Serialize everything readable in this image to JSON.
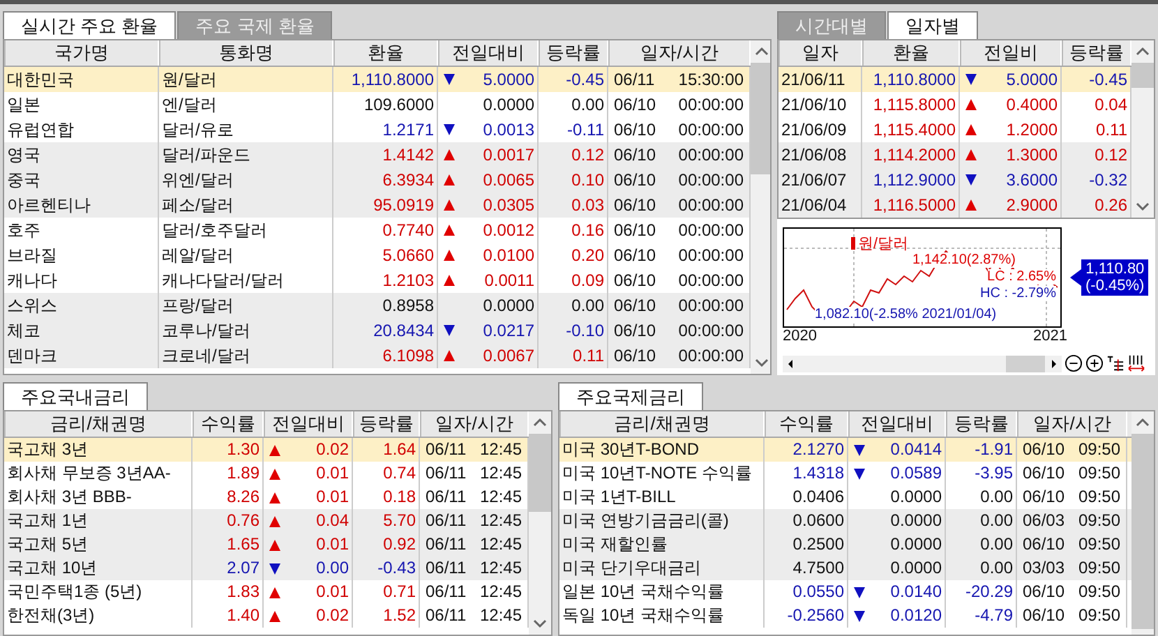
{
  "fx_panel": {
    "tabs": [
      {
        "label": "실시간 주요 환율",
        "selected": true
      },
      {
        "label": "주요 국제 환율",
        "selected": false
      }
    ],
    "columns": [
      "국가명",
      "통화명",
      "환율",
      "전일대비",
      "등락률",
      "일자/시간"
    ],
    "rows": [
      {
        "country": "대한민국",
        "currency": "원/달러",
        "rate": "1,110.8000",
        "kind": "down",
        "change": "5.0000",
        "change_rate": "-0.45",
        "date": "06/11",
        "time": "15:30:00",
        "selected": true
      },
      {
        "country": "일본",
        "currency": "엔/달러",
        "rate": "109.6000",
        "kind": "flat",
        "change": "0.0000",
        "change_rate": "0.00",
        "date": "06/10",
        "time": "00:00:00",
        "selected": false
      },
      {
        "country": "유럽연합",
        "currency": "달러/유로",
        "rate": "1.2171",
        "kind": "down",
        "change": "0.0013",
        "change_rate": "-0.11",
        "date": "06/10",
        "time": "00:00:00",
        "selected": false
      },
      {
        "country": "영국",
        "currency": "달러/파운드",
        "rate": "1.4142",
        "kind": "up",
        "change": "0.0017",
        "change_rate": "0.12",
        "date": "06/10",
        "time": "00:00:00",
        "selected": false
      },
      {
        "country": "중국",
        "currency": "위엔/달러",
        "rate": "6.3934",
        "kind": "up",
        "change": "0.0065",
        "change_rate": "0.10",
        "date": "06/10",
        "time": "00:00:00",
        "selected": false
      },
      {
        "country": "아르헨티나",
        "currency": "페소/달러",
        "rate": "95.0919",
        "kind": "up",
        "change": "0.0305",
        "change_rate": "0.03",
        "date": "06/10",
        "time": "00:00:00",
        "selected": false
      },
      {
        "country": "호주",
        "currency": "달러/호주달러",
        "rate": "0.7740",
        "kind": "up",
        "change": "0.0012",
        "change_rate": "0.16",
        "date": "06/10",
        "time": "00:00:00",
        "selected": false
      },
      {
        "country": "브라질",
        "currency": "레알/달러",
        "rate": "5.0660",
        "kind": "up",
        "change": "0.0100",
        "change_rate": "0.20",
        "date": "06/10",
        "time": "00:00:00",
        "selected": false
      },
      {
        "country": "캐나다",
        "currency": "캐나다달러/달러",
        "rate": "1.2103",
        "kind": "up",
        "change": "0.0011",
        "change_rate": "0.09",
        "date": "06/10",
        "time": "00:00:00",
        "selected": false
      },
      {
        "country": "스위스",
        "currency": "프랑/달러",
        "rate": "0.8958",
        "kind": "flat",
        "change": "0.0000",
        "change_rate": "0.00",
        "date": "06/10",
        "time": "00:00:00",
        "selected": false
      },
      {
        "country": "체코",
        "currency": "코루나/달러",
        "rate": "20.8434",
        "kind": "down",
        "change": "0.0217",
        "change_rate": "-0.10",
        "date": "06/10",
        "time": "00:00:00",
        "selected": false
      },
      {
        "country": "덴마크",
        "currency": "크로네/달러",
        "rate": "6.1098",
        "kind": "up",
        "change": "0.0067",
        "change_rate": "0.11",
        "date": "06/10",
        "time": "00:00:00",
        "selected": false
      }
    ]
  },
  "daily_panel": {
    "tabs": [
      {
        "label": "시간대별",
        "selected": false
      },
      {
        "label": "일자별",
        "selected": true
      }
    ],
    "columns": [
      "일자",
      "환율",
      "전일비",
      "등락률"
    ],
    "rows": [
      {
        "date": "21/06/11",
        "rate": "1,110.8000",
        "kind": "down",
        "change": "5.0000",
        "change_rate": "-0.45",
        "selected": true
      },
      {
        "date": "21/06/10",
        "rate": "1,115.8000",
        "kind": "up",
        "change": "0.4000",
        "change_rate": "0.04",
        "selected": false
      },
      {
        "date": "21/06/09",
        "rate": "1,115.4000",
        "kind": "up",
        "change": "1.2000",
        "change_rate": "0.11",
        "selected": false
      },
      {
        "date": "21/06/08",
        "rate": "1,114.2000",
        "kind": "up",
        "change": "1.3000",
        "change_rate": "0.12",
        "selected": false
      },
      {
        "date": "21/06/07",
        "rate": "1,112.9000",
        "kind": "down",
        "change": "3.6000",
        "change_rate": "-0.32",
        "selected": false
      },
      {
        "date": "21/06/04",
        "rate": "1,116.5000",
        "kind": "up",
        "change": "2.9000",
        "change_rate": "0.26",
        "selected": false
      }
    ],
    "mini_chart": {
      "legend": "원/달러",
      "high_label": "1,142.10(2.87%)",
      "lc_label": "LC : 2.65%",
      "hc_label": "HC : -2.79%",
      "low_label": "1,082.10(-2.58% 2021/01/04)",
      "price_tag": "1,110.80",
      "price_change": "(-0.45%)",
      "x_start": "2020",
      "x_end": "2021"
    }
  },
  "domestic_rates": {
    "tab": {
      "label": "주요국내금리",
      "selected": true
    },
    "columns": [
      "금리/채권명",
      "수익률",
      "전일대비",
      "등락률",
      "일자/시간"
    ],
    "rows": [
      {
        "name": "국고채 3년",
        "yield": "1.30",
        "kind": "up",
        "change": "0.02",
        "change_rate": "1.64",
        "date": "06/11",
        "time": "12:45",
        "selected": true
      },
      {
        "name": "회사채 무보증 3년AA-",
        "yield": "1.89",
        "kind": "up",
        "change": "0.01",
        "change_rate": "0.74",
        "date": "06/11",
        "time": "12:45",
        "selected": false
      },
      {
        "name": "회사채 3년 BBB-",
        "yield": "8.26",
        "kind": "up",
        "change": "0.01",
        "change_rate": "0.18",
        "date": "06/11",
        "time": "12:45",
        "selected": false
      },
      {
        "name": "국고채 1년",
        "yield": "0.76",
        "kind": "up",
        "change": "0.04",
        "change_rate": "5.70",
        "date": "06/11",
        "time": "12:45",
        "selected": false
      },
      {
        "name": "국고채 5년",
        "yield": "1.65",
        "kind": "up",
        "change": "0.01",
        "change_rate": "0.92",
        "date": "06/11",
        "time": "12:45",
        "selected": false
      },
      {
        "name": "국고채 10년",
        "yield": "2.07",
        "kind": "down",
        "change": "0.00",
        "change_rate": "-0.43",
        "date": "06/11",
        "time": "12:45",
        "selected": false
      },
      {
        "name": "국민주택1종 (5년)",
        "yield": "1.83",
        "kind": "up",
        "change": "0.01",
        "change_rate": "0.71",
        "date": "06/11",
        "time": "12:45",
        "selected": false
      },
      {
        "name": "한전채(3년)",
        "yield": "1.40",
        "kind": "up",
        "change": "0.02",
        "change_rate": "1.52",
        "date": "06/11",
        "time": "12:45",
        "selected": false
      }
    ]
  },
  "intl_rates": {
    "tab": {
      "label": "주요국제금리",
      "selected": true
    },
    "columns": [
      "금리/채권명",
      "수익률",
      "전일대비",
      "등락률",
      "일자/시간"
    ],
    "rows": [
      {
        "name": "미국 30년T-BOND",
        "yield": "2.1270",
        "kind": "down",
        "change": "0.0414",
        "change_rate": "-1.91",
        "date": "06/10",
        "time": "09:50",
        "selected": true
      },
      {
        "name": "미국 10년T-NOTE 수익률",
        "yield": "1.4318",
        "kind": "down",
        "change": "0.0589",
        "change_rate": "-3.95",
        "date": "06/10",
        "time": "09:50",
        "selected": false
      },
      {
        "name": "미국 1년T-BILL",
        "yield": "0.0406",
        "kind": "flat",
        "change": "0.0000",
        "change_rate": "0.00",
        "date": "06/10",
        "time": "09:50",
        "selected": false
      },
      {
        "name": "미국 연방기금금리(콜)",
        "yield": "0.0600",
        "kind": "flat",
        "change": "0.0000",
        "change_rate": "0.00",
        "date": "06/03",
        "time": "09:50",
        "selected": false
      },
      {
        "name": "미국 재할인률",
        "yield": "0.2500",
        "kind": "flat",
        "change": "0.0000",
        "change_rate": "0.00",
        "date": "06/10",
        "time": "09:50",
        "selected": false
      },
      {
        "name": "미국 단기우대금리",
        "yield": "4.7500",
        "kind": "flat",
        "change": "0.0000",
        "change_rate": "0.00",
        "date": "03/03",
        "time": "09:50",
        "selected": false
      },
      {
        "name": "일본 10년 국채수익률",
        "yield": "0.0550",
        "kind": "down",
        "change": "0.0140",
        "change_rate": "-20.29",
        "date": "06/10",
        "time": "09:50",
        "selected": false
      },
      {
        "name": "독일 10년 국채수익률",
        "yield": "-0.2560",
        "kind": "down",
        "change": "0.0120",
        "change_rate": "-4.79",
        "date": "06/10",
        "time": "09:50",
        "selected": false
      }
    ]
  }
}
